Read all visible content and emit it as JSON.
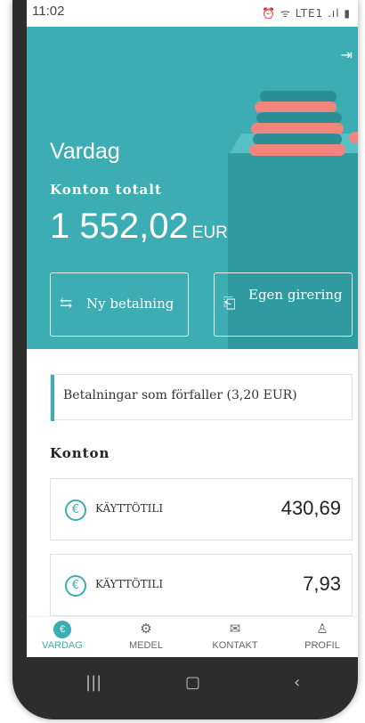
{
  "status_bar": {
    "time": "11:02",
    "icons_text": "⏰ ᯤ LTE1 .ıl ▮"
  },
  "hero": {
    "title": "Vardag",
    "subtitle": "Konton totalt",
    "amount": "1 552,02",
    "currency": "EUR",
    "buttons": {
      "new_payment": "Ny betalning",
      "own_transfer": "Egen girering"
    }
  },
  "due_payments": "Betalningar som förfaller (3,20 EUR)",
  "accounts_heading": "Konton",
  "accounts": [
    {
      "name": "KÄYTTÖTILI",
      "balance": "430,69"
    },
    {
      "name": "KÄYTTÖTILI",
      "balance": "7,93"
    }
  ],
  "bottom_nav": [
    {
      "label": "VARDAG",
      "icon": "euro-icon"
    },
    {
      "label": "MEDEL",
      "icon": "safe-icon"
    },
    {
      "label": "KONTAKT",
      "icon": "envelope-icon"
    },
    {
      "label": "PROFIL",
      "icon": "person-icon"
    }
  ],
  "colors": {
    "accent": "#3cadb3",
    "coin_pink": "#f0857e",
    "coin_teal": "#2c8f95"
  }
}
